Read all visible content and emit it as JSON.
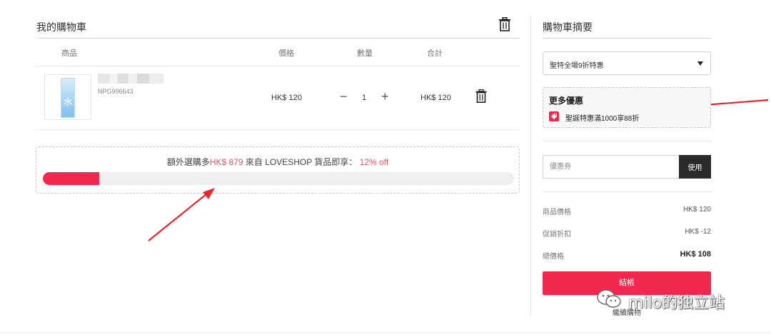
{
  "cart": {
    "title": "我的購物車",
    "columns": {
      "product": "商品",
      "price": "價格",
      "quantity": "數量",
      "subtotal": "合計"
    },
    "item": {
      "image_char": "水",
      "sku": "NPG996643",
      "price": "HK$ 120",
      "quantity": "1",
      "subtotal": "HK$ 120"
    },
    "promo": {
      "prefix": "額外選購多",
      "amount": "HK$ 879",
      "middle": " 來自 LOVESHOP 貨品即享：",
      "discount": "12% off",
      "progress_fraction": 0.12
    }
  },
  "summary": {
    "title": "購物車摘要",
    "promotion_select": "聖特全場9折特惠",
    "more_offers": {
      "title": "更多優惠",
      "item": "聖誕特惠滿1000享88折"
    },
    "coupon": {
      "placeholder": "優惠券",
      "button": "使用"
    },
    "lines": [
      {
        "label": "商品價格",
        "value": "HK$ 120"
      },
      {
        "label": "促銷折扣",
        "value": "HK$ -12"
      },
      {
        "label": "總價格",
        "value": "HK$ 108"
      }
    ],
    "checkout": "結帳",
    "continue": "繼續購物"
  },
  "watermark": {
    "text": "milo的独立站"
  },
  "colors": {
    "accent": "#f2284f",
    "promo_text": "#f0505f",
    "dark_button": "#2a2a2a"
  }
}
